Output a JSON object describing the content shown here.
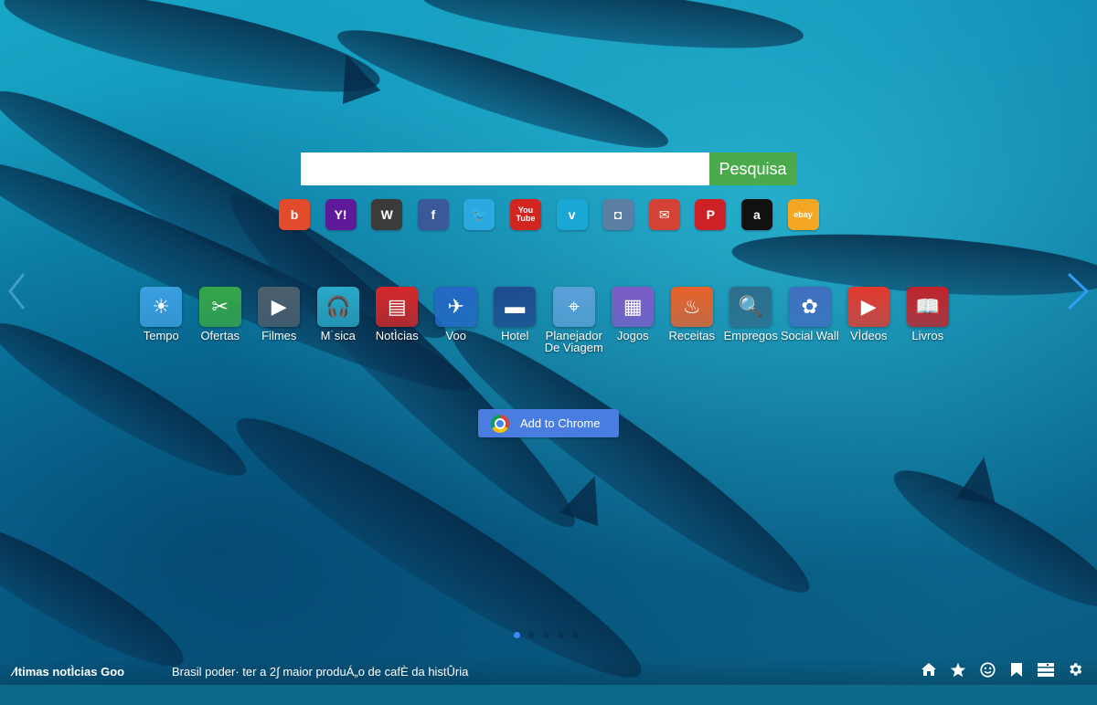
{
  "search": {
    "placeholder": "",
    "value": "",
    "button_label": "Pesquisa"
  },
  "quick_links": [
    {
      "name": "bing",
      "glyph": "b",
      "color": "#e24b2c"
    },
    {
      "name": "yahoo",
      "glyph": "Y!",
      "color": "#5f1a9a"
    },
    {
      "name": "wikipedia",
      "glyph": "W",
      "color": "#3b3b3b"
    },
    {
      "name": "facebook",
      "glyph": "f",
      "color": "#3b5998"
    },
    {
      "name": "twitter",
      "glyph": "🐦",
      "color": "#2aa9e0"
    },
    {
      "name": "youtube",
      "glyph": "You Tube",
      "color": "#d1261f"
    },
    {
      "name": "vimeo",
      "glyph": "v",
      "color": "#1aa7d6"
    },
    {
      "name": "instagram",
      "glyph": "◘",
      "color": "#5b7ea2"
    },
    {
      "name": "gmail",
      "glyph": "✉",
      "color": "#d44235"
    },
    {
      "name": "pinterest",
      "glyph": "P",
      "color": "#cc2127"
    },
    {
      "name": "amazon",
      "glyph": "a",
      "color": "#111111"
    },
    {
      "name": "ebay",
      "glyph": "ebay",
      "color": "#f5a623"
    }
  ],
  "apps": [
    {
      "id": "tempo",
      "label": "Tempo",
      "color": "#3b9fe0",
      "glyph": "☀"
    },
    {
      "id": "ofertas",
      "label": "Ofertas",
      "color": "#35a64a",
      "glyph": "✂"
    },
    {
      "id": "filmes",
      "label": "Filmes",
      "color": "#4c5f6e",
      "glyph": "▶"
    },
    {
      "id": "musica",
      "label": "M˙sica",
      "color": "#2aa9c9",
      "glyph": "🎧"
    },
    {
      "id": "noticias",
      "label": "NotÌcias",
      "color": "#d3282a",
      "glyph": "▤"
    },
    {
      "id": "voo",
      "label": "Voo",
      "color": "#2468c4",
      "glyph": "✈"
    },
    {
      "id": "hotel",
      "label": "Hotel",
      "color": "#1f4c8f",
      "glyph": "▬"
    },
    {
      "id": "planejador",
      "label": "Planejador De Viagem",
      "color": "#5aa0d8",
      "glyph": "⌖"
    },
    {
      "id": "jogos",
      "label": "Jogos",
      "color": "#7c5cc8",
      "glyph": "▦"
    },
    {
      "id": "receitas",
      "label": "Receitas",
      "color": "#e8612a",
      "glyph": "♨"
    },
    {
      "id": "empregos",
      "label": "Empregos",
      "color": "#2d6e8c",
      "glyph": "🔍"
    },
    {
      "id": "social-wall",
      "label": "Social Wall",
      "color": "#3f6fbf",
      "glyph": "✿"
    },
    {
      "id": "videos",
      "label": "VÌdeos",
      "color": "#e23a2e",
      "glyph": "▶"
    },
    {
      "id": "livros",
      "label": "Livros",
      "color": "#c0242b",
      "glyph": "📖"
    }
  ],
  "add_to_chrome": "Add to Chrome",
  "pagination": {
    "total": 5,
    "active": 0
  },
  "news": {
    "title": "⁄ltimas notÌcias Goo",
    "headline": "Brasil poder· ter a 2∫ maior produÁ„o de cafÈ da histÛria"
  },
  "bottom_icons": [
    "home-icon",
    "star-icon",
    "smiley-icon",
    "bookmark-icon",
    "list-icon",
    "gear-icon"
  ]
}
